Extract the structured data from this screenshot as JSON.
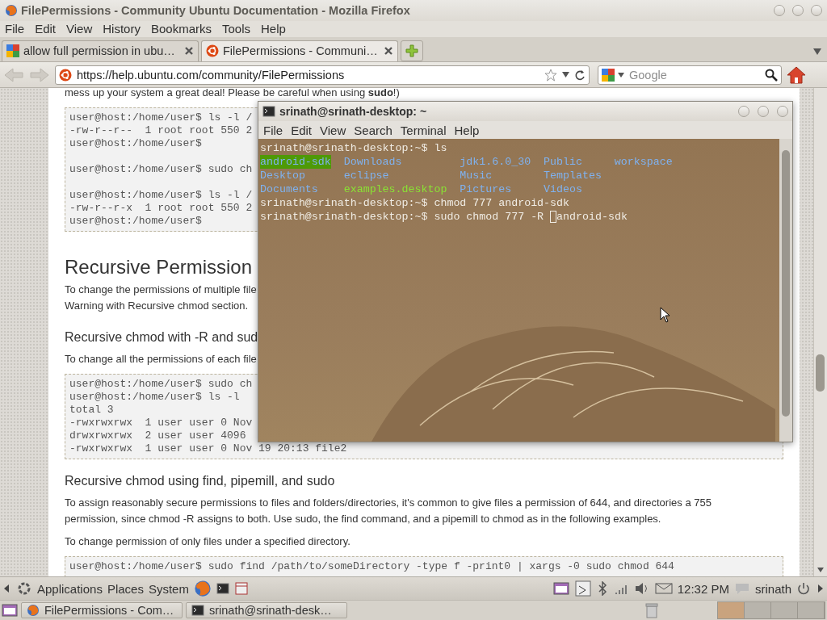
{
  "browser": {
    "title": "FilePermissions - Community Ubuntu Documentation - Mozilla Firefox",
    "menu": [
      "File",
      "Edit",
      "View",
      "History",
      "Bookmarks",
      "Tools",
      "Help"
    ],
    "tabs": [
      {
        "label": "allow full permission in ubu…",
        "selected": false
      },
      {
        "label": "FilePermissions - Communi…",
        "selected": true
      }
    ],
    "url": "https://help.ubuntu.com/community/FilePermissions",
    "search": {
      "placeholder": "Google"
    },
    "page": [
      {
        "kind": "para",
        "text": "mess up your system a great deal! Please be careful when using **sudo**!)"
      },
      {
        "kind": "code",
        "groups": [
          [
            "user@host:/home/user$ ls -l /",
            "-rw-r--r--  1 root root 550 2",
            "user@host:/home/user$"
          ],
          [
            "user@host:/home/user$ sudo ch"
          ],
          [
            "user@host:/home/user$ ls -l /",
            "-rw-r--r-x  1 root root 550 2",
            "user@host:/home/user$"
          ]
        ]
      },
      {
        "kind": "h2",
        "text": "Recursive Permission"
      },
      {
        "kind": "para",
        "text": "To change the permissions of multiple file\nWarning with Recursive chmod section."
      },
      {
        "kind": "h3",
        "text": "Recursive chmod with -R and sud"
      },
      {
        "kind": "para",
        "text": "To change all the permissions of each file"
      },
      {
        "kind": "code",
        "groups": [
          [
            "user@host:/home/user$ sudo ch",
            "user@host:/home/user$ ls -l",
            "total 3",
            "-rwxrwxrwx  1 user user 0 Nov",
            "drwxrwxrwx  2 user user 4096",
            "-rwxrwxrwx  1 user user 0 Nov 19 20:13 file2"
          ]
        ]
      },
      {
        "kind": "h3",
        "text": "Recursive chmod using find, pipemill, and sudo"
      },
      {
        "kind": "para",
        "text": "To assign reasonably secure permissions to files and folders/directories, it's common to give files a permission of 644, and directories a 755\npermission, since chmod -R assigns to both. Use sudo, the find command, and a pipemill to chmod as in the following examples."
      },
      {
        "kind": "para",
        "text": "To change permission of only files under a specified directory."
      },
      {
        "kind": "code",
        "groups": [
          [
            "user@host:/home/user$ sudo find /path/to/someDirectory -type f -print0 | xargs -0 sudo chmod 644"
          ]
        ]
      }
    ]
  },
  "terminal": {
    "title": "srinath@srinath-desktop: ~",
    "menu": [
      "File",
      "Edit",
      "View",
      "Search",
      "Terminal",
      "Help"
    ],
    "lines": [
      {
        "kind": "prompt",
        "prompt": "srinath@srinath-desktop:~$",
        "command": "ls"
      },
      {
        "kind": "listing",
        "entries": [
          {
            "name": "android-sdk",
            "kind": "dir_writable"
          },
          {
            "name": "Downloads",
            "kind": "dir"
          },
          {
            "name": "jdk1.6.0_30",
            "kind": "dir"
          },
          {
            "name": "Public",
            "kind": "dir"
          },
          {
            "name": "workspace",
            "kind": "dir"
          }
        ]
      },
      {
        "kind": "listing",
        "entries": [
          {
            "name": "Desktop",
            "kind": "dir"
          },
          {
            "name": "eclipse",
            "kind": "dir"
          },
          {
            "name": "Music",
            "kind": "dir"
          },
          {
            "name": "Templates",
            "kind": "dir"
          }
        ]
      },
      {
        "kind": "listing",
        "entries": [
          {
            "name": "Documents",
            "kind": "dir"
          },
          {
            "name": "examples.desktop",
            "kind": "file"
          },
          {
            "name": "Pictures",
            "kind": "dir"
          },
          {
            "name": "Videos",
            "kind": "dir"
          }
        ]
      },
      {
        "kind": "prompt",
        "prompt": "srinath@srinath-desktop:~$",
        "command": "chmod 777 android-sdk"
      },
      {
        "kind": "prompt",
        "prompt": "srinath@srinath-desktop:~$",
        "command": "sudo chmod 777 -R ",
        "cursor": true,
        "after_cursor": "android-sdk"
      }
    ]
  },
  "panel": {
    "menus": [
      "Applications",
      "Places",
      "System"
    ],
    "clock": "12:32 PM",
    "user": "srinath"
  },
  "taskbar": {
    "windows": [
      {
        "label": "FilePermissions - Com…"
      },
      {
        "label": "srinath@srinath-desk…"
      }
    ]
  }
}
